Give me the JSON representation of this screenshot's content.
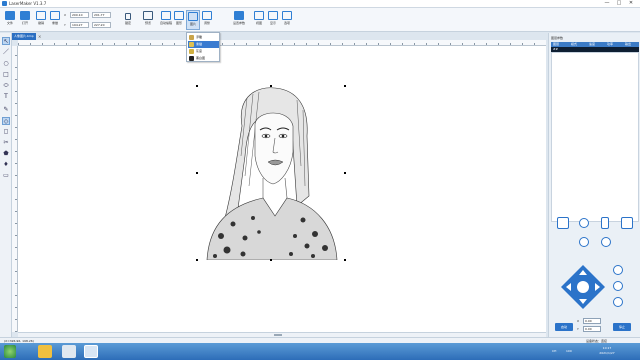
{
  "window": {
    "title": "LaserMaker V1.3.7",
    "controls": [
      "—",
      "□",
      "✕"
    ]
  },
  "toolbar": {
    "buttons": [
      {
        "label": "文件",
        "icon": "folder-icon"
      },
      {
        "label": "打开",
        "icon": "open-file-icon"
      },
      {
        "label": "撤销",
        "icon": "undo-icon"
      },
      {
        "label": "重做",
        "icon": "redo-icon"
      },
      {
        "label": "预览",
        "icon": "monitor-icon"
      },
      {
        "label": "自动编程",
        "icon": "vector-icon"
      },
      {
        "label": "图形",
        "icon": "shapes-icon"
      },
      {
        "label": "图片",
        "icon": "image-icon"
      },
      {
        "label": "调整",
        "icon": "adjust-icon"
      },
      {
        "label": "设置参数",
        "icon": "settings-icon"
      },
      {
        "label": "视图",
        "icon": "view-icon"
      },
      {
        "label": "显示",
        "icon": "display-icon"
      },
      {
        "label": "选项",
        "icon": "options-icon"
      }
    ],
    "coords": {
      "x_label": "X",
      "x_value": "200.10",
      "y_label": "Y",
      "y_value": "194.27",
      "w_value": "201.77",
      "h_value": "227.20",
      "lock_label": "锁定"
    }
  },
  "dropdown": {
    "items": [
      {
        "label": "浮雕",
        "icon": "emboss-icon"
      },
      {
        "label": "素描",
        "icon": "sketch-icon",
        "selected": true
      },
      {
        "label": "灰度",
        "icon": "grayscale-icon"
      },
      {
        "label": "黑白图",
        "icon": "bw-icon"
      }
    ]
  },
  "left_tools": [
    "↖",
    "／",
    "○",
    "□",
    "⬭",
    "T",
    "✎",
    "◇",
    "◻",
    "✂",
    "⬟",
    "♦",
    "▭"
  ],
  "document": {
    "tab_label": "人像图片.bmp",
    "close": "✕"
  },
  "right_panel": {
    "title": "图层参数",
    "columns": [
      "图层",
      "模式",
      "速度",
      "功率",
      "输出"
    ],
    "row": [
      "##",
      "",
      "",
      "",
      ""
    ],
    "controls": {
      "x_label": "X",
      "x_value": "0.00",
      "y_label": "Y",
      "y_value": "0.00",
      "start_label": "启动",
      "stop_label": "停止"
    }
  },
  "status": {
    "coords": "(X=326.96, 198.26)",
    "connection": "设备状态：连接"
  },
  "taskbar": {
    "tray_items": [
      "CH",
      "100"
    ],
    "time": "10:17",
    "date": "2021/1/27"
  },
  "colors": {
    "accent": "#2b73c9",
    "title_bar": "#ffffff",
    "taskbar": "#2d6db8"
  }
}
